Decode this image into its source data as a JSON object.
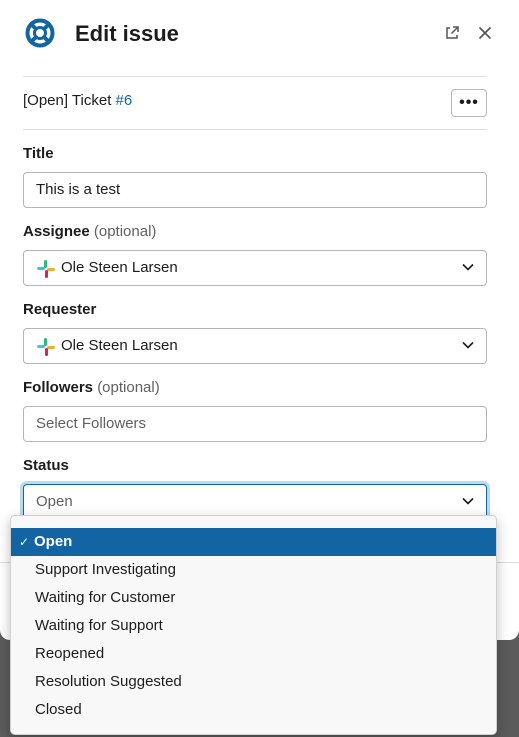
{
  "header": {
    "title": "Edit issue",
    "icons": [
      "lifebuoy-logo-icon",
      "external-link-icon",
      "close-icon"
    ]
  },
  "ticket": {
    "prefix": "[Open] Ticket ",
    "number": "#6",
    "more_label": "•••"
  },
  "form": {
    "title": {
      "label": "Title",
      "value": "This is a test"
    },
    "assignee": {
      "label": "Assignee",
      "optional": "(optional)",
      "value": "Ole Steen Larsen"
    },
    "requester": {
      "label": "Requester",
      "value": "Ole Steen Larsen"
    },
    "followers": {
      "label": "Followers",
      "optional": "(optional)",
      "placeholder": "Select Followers"
    },
    "status": {
      "label": "Status",
      "value": "Open"
    }
  },
  "status_menu": {
    "options": [
      {
        "label": "Open",
        "selected": true
      },
      {
        "label": "Support Investigating",
        "selected": false
      },
      {
        "label": "Waiting for Customer",
        "selected": false
      },
      {
        "label": "Waiting for Support",
        "selected": false
      },
      {
        "label": "Reopened",
        "selected": false
      },
      {
        "label": "Resolution Suggested",
        "selected": false
      },
      {
        "label": "Closed",
        "selected": false
      }
    ],
    "check_mark": "✓"
  },
  "colors": {
    "accent": "#1264a3",
    "focus_ring": "#b9dbef",
    "overlay": "#5b5b5b"
  }
}
